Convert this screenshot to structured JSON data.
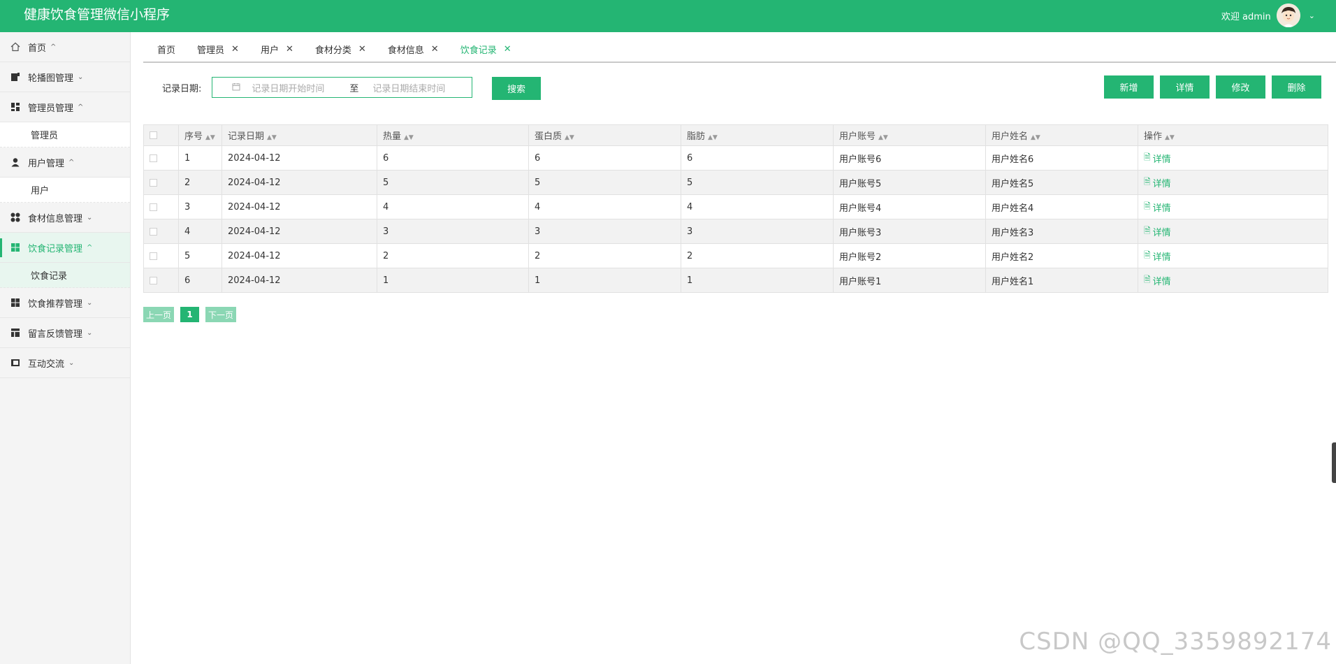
{
  "app": {
    "title": "健康饮食管理微信小程序",
    "welcome": "欢迎 admin"
  },
  "sidebar": {
    "items": [
      {
        "label": "首页",
        "icon": "home-icon",
        "arrow": "^"
      },
      {
        "label": "轮播图管理",
        "icon": "image-icon",
        "arrow": "⌄"
      },
      {
        "label": "管理员管理",
        "icon": "dashboard-icon",
        "arrow": "^",
        "sub": [
          "管理员"
        ]
      },
      {
        "label": "用户管理",
        "icon": "user-icon",
        "arrow": "^",
        "sub": [
          "用户"
        ]
      },
      {
        "label": "食材信息管理",
        "icon": "grid-dots-icon",
        "arrow": "⌄"
      },
      {
        "label": "饮食记录管理",
        "icon": "grid-icon",
        "arrow": "^",
        "sub": [
          "饮食记录"
        ]
      },
      {
        "label": "饮食推荐管理",
        "icon": "grid-icon",
        "arrow": "⌄"
      },
      {
        "label": "留言反馈管理",
        "icon": "table-icon",
        "arrow": "⌄"
      },
      {
        "label": "互动交流",
        "icon": "book-icon",
        "arrow": "⌄"
      }
    ]
  },
  "tabs": [
    {
      "label": "首页"
    },
    {
      "label": "管理员"
    },
    {
      "label": "用户"
    },
    {
      "label": "食材分类"
    },
    {
      "label": "食材信息"
    },
    {
      "label": "饮食记录"
    }
  ],
  "search": {
    "label": "记录日期:",
    "start_placeholder": "记录日期开始时间",
    "separator": "至",
    "end_placeholder": "记录日期结束时间",
    "button": "搜索"
  },
  "actions": {
    "add": "新增",
    "detail": "详情",
    "edit": "修改",
    "delete": "删除"
  },
  "table": {
    "headers": [
      "序号",
      "记录日期",
      "热量",
      "蛋白质",
      "脂肪",
      "用户账号",
      "用户姓名",
      "操作"
    ],
    "rows": [
      [
        "1",
        "2024-04-12",
        "6",
        "6",
        "6",
        "用户账号6",
        "用户姓名6"
      ],
      [
        "2",
        "2024-04-12",
        "5",
        "5",
        "5",
        "用户账号5",
        "用户姓名5"
      ],
      [
        "3",
        "2024-04-12",
        "4",
        "4",
        "4",
        "用户账号4",
        "用户姓名4"
      ],
      [
        "4",
        "2024-04-12",
        "3",
        "3",
        "3",
        "用户账号3",
        "用户姓名3"
      ],
      [
        "5",
        "2024-04-12",
        "2",
        "2",
        "2",
        "用户账号2",
        "用户姓名2"
      ],
      [
        "6",
        "2024-04-12",
        "1",
        "1",
        "1",
        "用户账号1",
        "用户姓名1"
      ]
    ],
    "row_action": "详情"
  },
  "pagination": {
    "prev": "上一页",
    "page": "1",
    "next": "下一页"
  },
  "watermark": "CSDN @QQ_3359892174",
  "colors": {
    "primary": "#24b573",
    "primary_light": "#8bd7b4"
  }
}
